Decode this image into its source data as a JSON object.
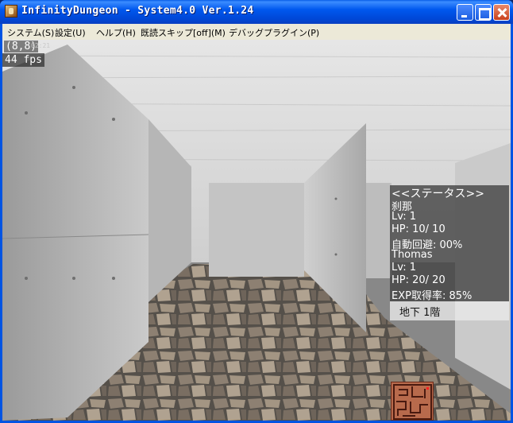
{
  "window": {
    "title": "InfinityDungeon - System4.0 Ver.1.24"
  },
  "menu": {
    "items": [
      {
        "label": "システム(S)"
      },
      {
        "label": "設定(U)"
      },
      {
        "label": "ヘルプ(H)"
      },
      {
        "label": "既読スキップ[off](M)"
      },
      {
        "label": "デバッグプラグイン(P)"
      }
    ]
  },
  "hud": {
    "coords": "(8,8)",
    "timer": "02:21",
    "fps": "44 fps"
  },
  "status": {
    "header": "<<ステータス>>",
    "char1_name": "刹那",
    "char1_lv": " Lv:     1",
    "char1_hp": " HP:   10/   10",
    "char1_skill": " 自動回避:  00%",
    "char2_name": "Thomas",
    "char2_lv": " Lv:     1",
    "char2_hp": " HP:   20/   20",
    "char2_exp": "EXP取得率:  85%"
  },
  "floor": {
    "label": "地下  1階"
  },
  "colors": {
    "titlebar": "#0058ee",
    "menubar": "#ece9d8",
    "wall": "#c8c8c8",
    "ceiling": "#dedede",
    "floor": "#6d6155"
  }
}
